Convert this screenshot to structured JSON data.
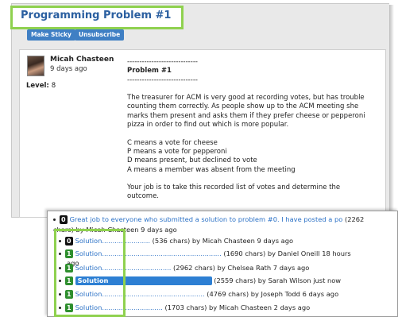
{
  "thread": {
    "title": "Programming Problem #1",
    "buttons": {
      "sticky": "Make Sticky",
      "unsubscribe": "Unsubscribe"
    }
  },
  "post": {
    "author": "Micah Chasteen",
    "posted": "9 days ago",
    "level_label": "Level:",
    "level_value": "8",
    "lines": [
      {
        "text": "-----------------------------",
        "bold": false
      },
      {
        "text": "Problem #1",
        "bold": true
      },
      {
        "text": "-----------------------------",
        "bold": false
      },
      {
        "text": "",
        "bold": false
      },
      {
        "text": "The treasurer for ACM is very good at recording votes, but has trouble",
        "bold": false
      },
      {
        "text": "counting them correctly. As people show up to the ACM meeting she",
        "bold": false
      },
      {
        "text": "marks them present and asks them if they prefer cheese or pepperoni",
        "bold": false
      },
      {
        "text": "pizza in order to find out which is more popular.",
        "bold": false
      },
      {
        "text": "",
        "bold": false
      },
      {
        "text": "C means a vote for cheese",
        "bold": false
      },
      {
        "text": "P means a vote for pepperoni",
        "bold": false
      },
      {
        "text": "D means present, but declined to vote",
        "bold": false
      },
      {
        "text": "A means a member was absent from the meeting",
        "bold": false
      },
      {
        "text": "",
        "bold": false
      },
      {
        "text": "Your job is to take this recorded list of votes and determine the",
        "bold": false
      },
      {
        "text": "outcome.",
        "bold": false
      }
    ]
  },
  "replies": {
    "top": {
      "badge": "0",
      "link": "Great job to everyone who submitted a solution to problem #0. I have posted a po",
      "rest": " (2262",
      "cont": "chars) by Micah Chasteen 9 days ago"
    },
    "items": [
      {
        "badge": "0",
        "badge_color": "black",
        "link": "Solution.......................",
        "meta": " (536 chars) by Micah Chasteen 9 days ago",
        "cont": "",
        "selected": false
      },
      {
        "badge": "1",
        "badge_color": "green",
        "link": "Solution.........................................................",
        "meta": " (1690 chars) by Daniel Oneill 18 hours",
        "cont": "ago",
        "selected": false
      },
      {
        "badge": "1",
        "badge_color": "green",
        "link": "Solution.................................",
        "meta": " (2962 chars) by Chelsea Rath 7 days ago",
        "cont": "",
        "selected": false
      },
      {
        "badge": "1",
        "badge_color": "green",
        "link": "Solution",
        "meta": " (2559 chars) by Sarah Wilson just now",
        "cont": "",
        "selected": true
      },
      {
        "badge": "1",
        "badge_color": "green",
        "link": "Solution.................................................",
        "meta": " (4769 chars) by Joseph Todd 6 days ago",
        "cont": "",
        "selected": false
      },
      {
        "badge": "1",
        "badge_color": "green",
        "link": "Solution.............................",
        "meta": " (1703 chars) by Micah Chasteen 2 days ago",
        "cont": "",
        "selected": false
      }
    ]
  },
  "colors": {
    "highlight": "#8fd14f",
    "link": "#2b71c6",
    "title": "#2b5fa0",
    "button": "#3f7fc4"
  }
}
